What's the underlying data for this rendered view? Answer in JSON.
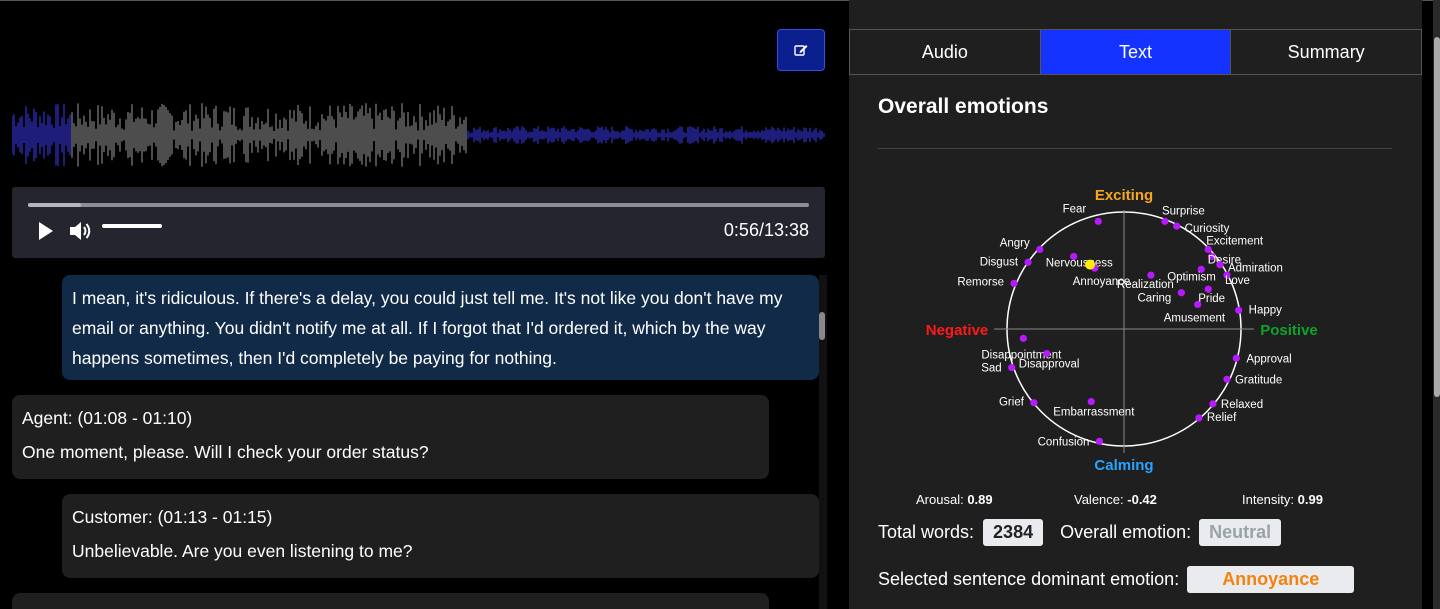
{
  "player": {
    "time": "0:56/13:38",
    "progress": 0.068,
    "volume": 1.0
  },
  "transcript": [
    {
      "text": "I mean, it's ridiculous. If there's a delay, you could just tell me. It's not like you don't have my email or anything. You didn't notify me at all. If I forgot that I'd ordered it, which by the way happens sometimes, then I'd completely be paying for nothing.",
      "selected": true
    },
    {
      "speaker": "Agent: (01:08 - 01:10)",
      "text": "One moment, please. Will I check your order status?"
    },
    {
      "speaker": "Customer: (01:13 - 01:15)",
      "text": "Unbelievable. Are you even listening to me?"
    }
  ],
  "tabs": [
    {
      "label": "Audio",
      "active": false
    },
    {
      "label": "Text",
      "active": true
    },
    {
      "label": "Summary",
      "active": false
    }
  ],
  "panel": {
    "title": "Overall emotions",
    "wheel": {
      "top_label": "Exciting",
      "bottom_label": "Calming",
      "left_label": "Negative",
      "right_label": "Positive",
      "top_color": "#f5a623",
      "bottom_color": "#29a3ff",
      "left_color": "#ff1a1a",
      "right_color": "#0fa32a",
      "point_color": "#b81aff",
      "selected_color": "#ffee00",
      "emotions": [
        {
          "name": "Fear",
          "valence": -0.22,
          "arousal": 0.92
        },
        {
          "name": "Surprise",
          "valence": 0.35,
          "arousal": 0.92
        },
        {
          "name": "Curiosity",
          "valence": 0.45,
          "arousal": 0.88
        },
        {
          "name": "Excitement",
          "valence": 0.72,
          "arousal": 0.68
        },
        {
          "name": "Desire",
          "valence": 0.75,
          "arousal": 0.62
        },
        {
          "name": "Admiration",
          "valence": 0.82,
          "arousal": 0.55
        },
        {
          "name": "Love",
          "valence": 0.88,
          "arousal": 0.46
        },
        {
          "name": "Angry",
          "valence": -0.72,
          "arousal": 0.68
        },
        {
          "name": "Disgust",
          "valence": -0.82,
          "arousal": 0.57
        },
        {
          "name": "Nervousness",
          "valence": -0.43,
          "arousal": 0.62
        },
        {
          "name": "Annoyance",
          "valence": -0.25,
          "arousal": 0.52
        },
        {
          "name": "Realization",
          "valence": 0.23,
          "arousal": 0.46
        },
        {
          "name": "Optimism",
          "valence": 0.66,
          "arousal": 0.51
        },
        {
          "name": "Caring",
          "valence": 0.49,
          "arousal": 0.31
        },
        {
          "name": "Pride",
          "valence": 0.72,
          "arousal": 0.34
        },
        {
          "name": "Amusement",
          "valence": 0.63,
          "arousal": 0.21
        },
        {
          "name": "Remorse",
          "valence": -0.94,
          "arousal": 0.39
        },
        {
          "name": "Happy",
          "valence": 0.98,
          "arousal": 0.16
        },
        {
          "name": "Disappointment",
          "valence": -0.86,
          "arousal": -0.08
        },
        {
          "name": "Disapproval",
          "valence": -0.66,
          "arousal": -0.21
        },
        {
          "name": "Sad",
          "valence": -0.96,
          "arousal": -0.33
        },
        {
          "name": "Approval",
          "valence": 0.96,
          "arousal": -0.25
        },
        {
          "name": "Gratitude",
          "valence": 0.88,
          "arousal": -0.43
        },
        {
          "name": "Grief",
          "valence": -0.77,
          "arousal": -0.63
        },
        {
          "name": "Embarrassment",
          "valence": -0.28,
          "arousal": -0.62
        },
        {
          "name": "Relaxed",
          "valence": 0.76,
          "arousal": -0.64
        },
        {
          "name": "Relief",
          "valence": 0.64,
          "arousal": -0.76
        },
        {
          "name": "Confusion",
          "valence": -0.21,
          "arousal": -0.96
        }
      ],
      "selected": {
        "valence": -0.29,
        "arousal": 0.55
      }
    },
    "arousal_label": "Arousal:",
    "arousal_value": "0.89",
    "valence_label": "Valence:",
    "valence_value": "-0.42",
    "intensity_label": "Intensity:",
    "intensity_value": "0.99",
    "total_words_label": "Total words:",
    "total_words_value": "2384",
    "overall_emotion_label": "Overall emotion:",
    "overall_emotion_value": "Neutral",
    "overall_emotion_color": "#9aa3a8",
    "selected_label": "Selected sentence dominant emotion:",
    "selected_value": "Annoyance",
    "selected_value_color": "#f5820f"
  },
  "colors": {
    "waveform_played": "#3b3bf5",
    "waveform_unplayed": "#9a9a9a",
    "active_tab": "#1433ff"
  }
}
